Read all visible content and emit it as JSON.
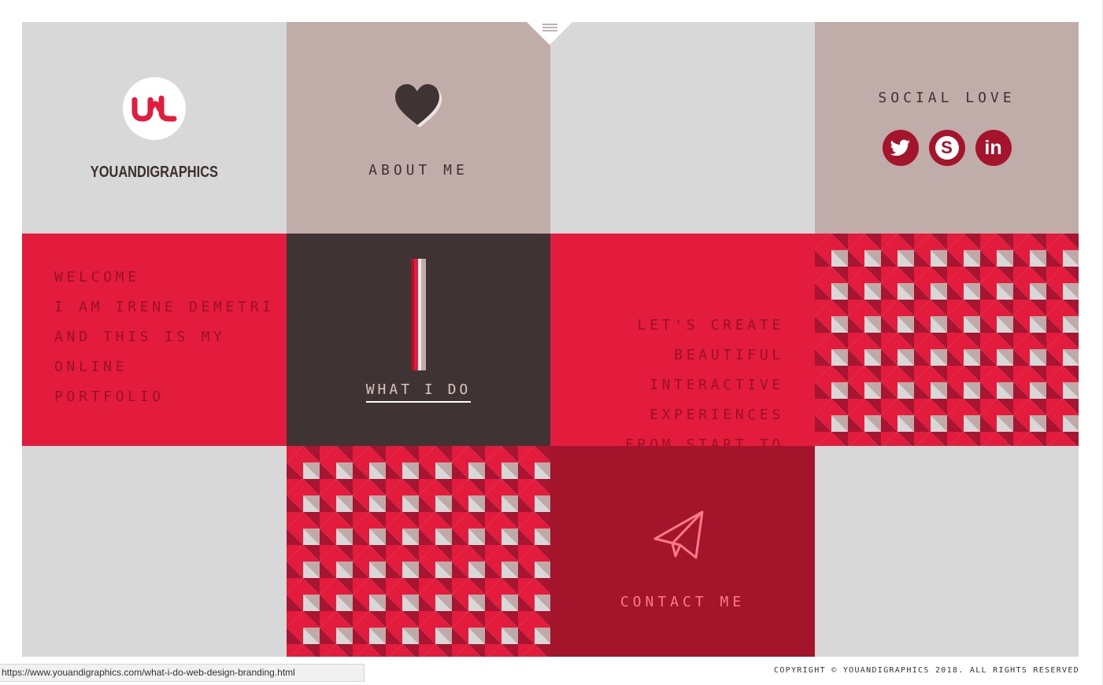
{
  "logo": {
    "brand_name": "YOUANDIGRAPHICS",
    "mark": "ul"
  },
  "about": {
    "label": "ABOUT ME",
    "icon": "heart-icon"
  },
  "social": {
    "heading": "SOCIAL LOVE",
    "items": [
      {
        "icon": "twitter-icon",
        "text": ""
      },
      {
        "icon": "skype-icon",
        "text": "S"
      },
      {
        "icon": "linkedin-icon",
        "text": "in"
      }
    ],
    "color": "#a4142b"
  },
  "welcome": {
    "line1": "WELCOME",
    "line2": "I AM IRENE DEMETRI",
    "line3": "AND THIS IS MY ONLINE",
    "line4": "PORTFOLIO"
  },
  "what_i_do": {
    "label": "WHAT I DO"
  },
  "create": {
    "line1": "LET'S CREATE",
    "line2": "BEAUTIFUL INTERACTIVE",
    "line3": "EXPERIENCES",
    "line4": "FROM START TO FINISH"
  },
  "contact": {
    "label": "CONTACT ME",
    "icon": "paper-plane-icon"
  },
  "menu": {
    "icon": "hamburger-menu-icon"
  },
  "footer": {
    "copyright": "COPYRIGHT © YOUANDIGRAPHICS 2018. ALL RIGHTS RESERVED"
  },
  "status_bar": {
    "url": "https://www.youandigraphics.com/what-i-do-web-design-branding.html"
  },
  "colors": {
    "red": "#e31c3d",
    "dark_red": "#a4142b",
    "brown": "#403333",
    "mauve": "#c0ada9",
    "grey": "#d9d8d9"
  }
}
